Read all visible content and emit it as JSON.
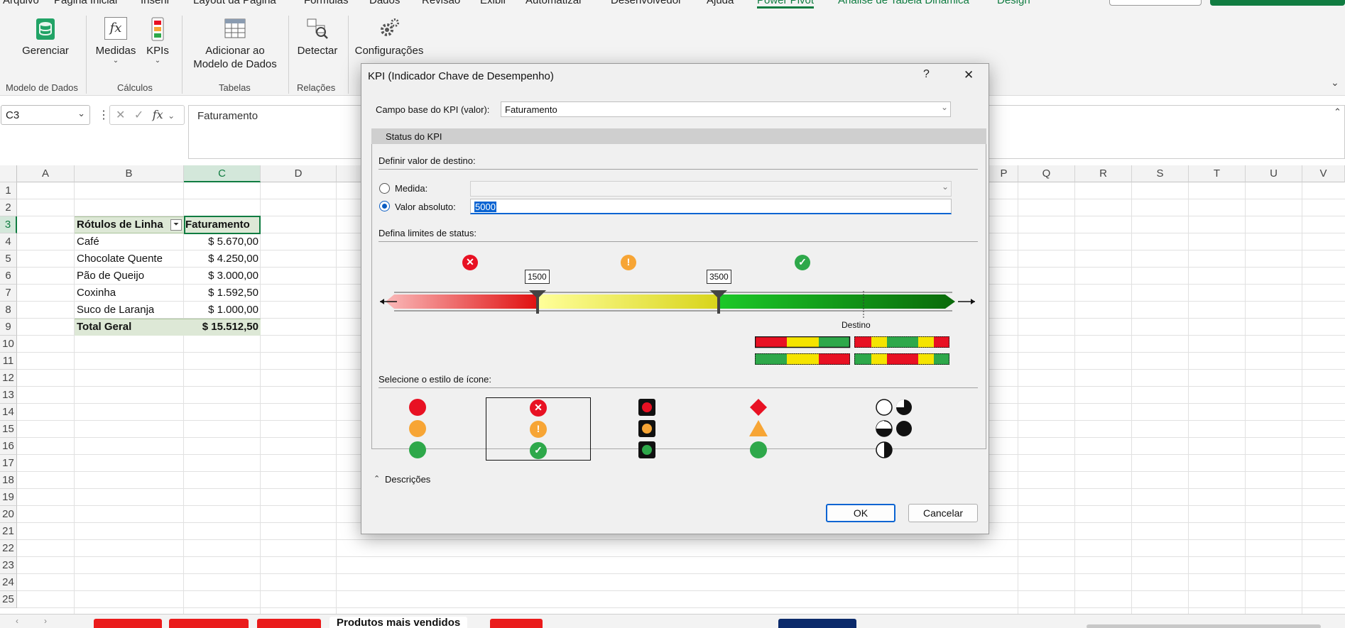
{
  "ribbon": {
    "tabs": [
      "Arquivo",
      "Página Inicial",
      "Inserir",
      "Layout da Página",
      "Fórmulas",
      "Dados",
      "Revisão",
      "Exibir",
      "Automatizar",
      "Desenvolvedor",
      "Ajuda",
      "Power Pivot",
      "Análise de Tabela Dinâmica",
      "Design"
    ],
    "buttons": {
      "gerenciar": "Gerenciar",
      "medidas": "Medidas",
      "kpis": "KPIs",
      "adicionar_l1": "Adicionar ao",
      "adicionar_l2": "Modelo de Dados",
      "detectar": "Detectar",
      "configuracoes": "Configurações"
    },
    "groups": {
      "modelo": "Modelo de Dados",
      "calculos": "Cálculos",
      "tabelas": "Tabelas",
      "relacoes": "Relações"
    }
  },
  "formula_bar": {
    "name_box": "C3",
    "fx": "fx",
    "content": "Faturamento"
  },
  "sheet": {
    "columns_left": [
      "A",
      "B",
      "C",
      "D"
    ],
    "columns_right": [
      "P",
      "Q",
      "R",
      "S",
      "T",
      "U",
      "V"
    ],
    "rows": [
      "1",
      "2",
      "3",
      "4",
      "5",
      "6",
      "7",
      "8",
      "9",
      "10",
      "11",
      "12",
      "13",
      "14",
      "15",
      "16",
      "17",
      "18",
      "19",
      "20",
      "21",
      "22",
      "23",
      "24",
      "25"
    ],
    "pivot": {
      "header_label": "Rótulos de Linha",
      "header_value": "Faturamento",
      "rows": [
        {
          "label": "Café",
          "value": "$ 5.670,00"
        },
        {
          "label": "Chocolate Quente",
          "value": "$ 4.250,00"
        },
        {
          "label": "Pão de Queijo",
          "value": "$ 3.000,00"
        },
        {
          "label": "Coxinha",
          "value": "$ 1.592,50"
        },
        {
          "label": "Suco de Laranja",
          "value": "$ 1.000,00"
        }
      ],
      "total_label": "Total Geral",
      "total_value": "$ 15.512,50"
    }
  },
  "sheet_tabs": {
    "active": "Produtos mais vendidos"
  },
  "dialog": {
    "title": "KPI (Indicador Chave de Desempenho)",
    "help": "?",
    "close": "✕",
    "base_field_label": "Campo base do KPI (valor):",
    "base_field_value": "Faturamento",
    "status_header": "Status do KPI",
    "target_section": "Definir valor de destino:",
    "measure_label": "Medida:",
    "absolute_label": "Valor absoluto:",
    "absolute_value": "5000",
    "limits_section": "Defina limites de status:",
    "threshold_low": "1500",
    "threshold_high": "3500",
    "target_marker": "Destino",
    "icon_style_section": "Selecione o estilo de ícone:",
    "descriptions": "Descrições",
    "ok": "OK",
    "cancel": "Cancelar",
    "colors": {
      "red": "#e81123",
      "yellow": "#f7a535",
      "green": "#2ea84a"
    }
  }
}
